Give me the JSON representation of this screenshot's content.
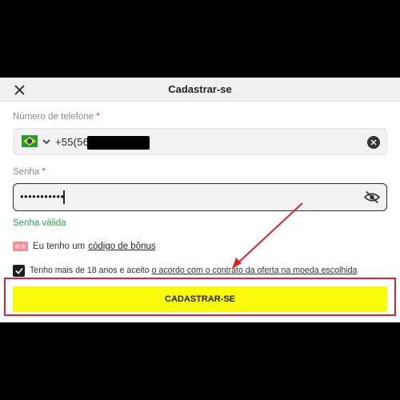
{
  "header": {
    "title": "Cadastrar-se",
    "close_icon": "close-icon"
  },
  "phone": {
    "label": "Número de telefone",
    "required_mark": "*",
    "country_flag": "brazil-flag-icon",
    "value": "+55(56)",
    "clear_icon": "clear-icon"
  },
  "password": {
    "label": "Senha",
    "required_mark": "*",
    "value": "•••••••••••",
    "visibility_icon": "eye-off-icon",
    "validation": "Senha válida"
  },
  "bonus": {
    "prefix": "Eu tenho um",
    "link": "código de bônus",
    "icon": "ticket-icon"
  },
  "terms": {
    "checked": true,
    "text": "Tenho mais de 18 anos e aceito",
    "link": "o acordo com o contrato da oferta na moeda escolhida"
  },
  "submit": {
    "label": "CADASTRAR-SE"
  },
  "colors": {
    "accent_button": "#f8fa0a",
    "valid_text": "#2e9e4f",
    "required": "#e53935",
    "annotation": "#e0212b"
  }
}
